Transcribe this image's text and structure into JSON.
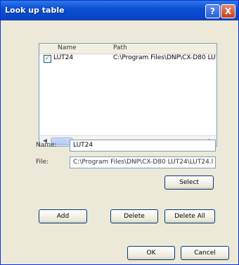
{
  "window": {
    "title": "Look up table",
    "help_glyph": "?",
    "close_glyph": "X"
  },
  "list": {
    "columns": [
      "Name",
      "Path"
    ],
    "rows": [
      {
        "checked": true,
        "name": "LUT24",
        "path": "C:\\Program Files\\DNP\\CX-D80 LUT24\\LUT24.l"
      }
    ],
    "scroll_left_glyph": "◀",
    "scroll_right_glyph": "▶"
  },
  "form": {
    "name_label": "Name:",
    "name_value": "LUT24",
    "file_label": "File:",
    "file_value": "C:\\Program Files\\DNP\\CX-D80 LUT24\\LUT24.l"
  },
  "buttons": {
    "select": "Select",
    "add": "Add",
    "delete": "Delete",
    "delete_all": "Delete All",
    "ok": "OK",
    "cancel": "Cancel"
  }
}
